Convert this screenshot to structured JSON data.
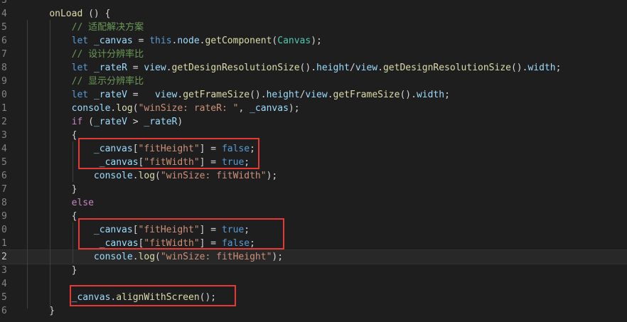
{
  "editor": {
    "lines": [
      {
        "number": "3",
        "tokens": []
      },
      {
        "number": "4",
        "tokens": [
          {
            "text": "    ",
            "cls": "pun"
          },
          {
            "text": "onLoad",
            "cls": "fn"
          },
          {
            "text": " () {",
            "cls": "pun"
          }
        ]
      },
      {
        "number": "5",
        "tokens": [
          {
            "text": "        ",
            "cls": "pun"
          },
          {
            "text": "// 适配解决方案",
            "cls": "cmt"
          }
        ]
      },
      {
        "number": "6",
        "tokens": [
          {
            "text": "        ",
            "cls": "pun"
          },
          {
            "text": "let",
            "cls": "kw"
          },
          {
            "text": " ",
            "cls": "pun"
          },
          {
            "text": "_canvas",
            "cls": "var"
          },
          {
            "text": " = ",
            "cls": "pun"
          },
          {
            "text": "this",
            "cls": "kw"
          },
          {
            "text": ".",
            "cls": "pun"
          },
          {
            "text": "node",
            "cls": "var"
          },
          {
            "text": ".",
            "cls": "pun"
          },
          {
            "text": "getComponent",
            "cls": "fn"
          },
          {
            "text": "(",
            "cls": "pun"
          },
          {
            "text": "Canvas",
            "cls": "cls"
          },
          {
            "text": ");",
            "cls": "pun"
          }
        ]
      },
      {
        "number": "7",
        "tokens": [
          {
            "text": "        ",
            "cls": "pun"
          },
          {
            "text": "// 设计分辨率比",
            "cls": "cmt"
          }
        ]
      },
      {
        "number": "8",
        "tokens": [
          {
            "text": "        ",
            "cls": "pun"
          },
          {
            "text": "let",
            "cls": "kw"
          },
          {
            "text": " ",
            "cls": "pun"
          },
          {
            "text": "_rateR",
            "cls": "var"
          },
          {
            "text": " = ",
            "cls": "pun"
          },
          {
            "text": "view",
            "cls": "var"
          },
          {
            "text": ".",
            "cls": "pun"
          },
          {
            "text": "getDesignResolutionSize",
            "cls": "fn"
          },
          {
            "text": "().",
            "cls": "pun"
          },
          {
            "text": "height",
            "cls": "var"
          },
          {
            "text": "/",
            "cls": "pun"
          },
          {
            "text": "view",
            "cls": "var"
          },
          {
            "text": ".",
            "cls": "pun"
          },
          {
            "text": "getDesignResolutionSize",
            "cls": "fn"
          },
          {
            "text": "().",
            "cls": "pun"
          },
          {
            "text": "width",
            "cls": "var"
          },
          {
            "text": ";",
            "cls": "pun"
          }
        ]
      },
      {
        "number": "9",
        "tokens": [
          {
            "text": "        ",
            "cls": "pun"
          },
          {
            "text": "// 显示分辨率比",
            "cls": "cmt"
          }
        ]
      },
      {
        "number": "0",
        "tokens": [
          {
            "text": "        ",
            "cls": "pun"
          },
          {
            "text": "let",
            "cls": "kw"
          },
          {
            "text": " ",
            "cls": "pun"
          },
          {
            "text": "_rateV",
            "cls": "var"
          },
          {
            "text": " =   ",
            "cls": "pun"
          },
          {
            "text": "view",
            "cls": "var"
          },
          {
            "text": ".",
            "cls": "pun"
          },
          {
            "text": "getFrameSize",
            "cls": "fn"
          },
          {
            "text": "().",
            "cls": "pun"
          },
          {
            "text": "height",
            "cls": "var"
          },
          {
            "text": "/",
            "cls": "pun"
          },
          {
            "text": "view",
            "cls": "var"
          },
          {
            "text": ".",
            "cls": "pun"
          },
          {
            "text": "getFrameSize",
            "cls": "fn"
          },
          {
            "text": "().",
            "cls": "pun"
          },
          {
            "text": "width",
            "cls": "var"
          },
          {
            "text": ";",
            "cls": "pun"
          }
        ]
      },
      {
        "number": "1",
        "tokens": [
          {
            "text": "        ",
            "cls": "pun"
          },
          {
            "text": "console",
            "cls": "var"
          },
          {
            "text": ".",
            "cls": "pun"
          },
          {
            "text": "log",
            "cls": "fn"
          },
          {
            "text": "(",
            "cls": "pun"
          },
          {
            "text": "\"winSize: rateR: \"",
            "cls": "str"
          },
          {
            "text": ", ",
            "cls": "pun"
          },
          {
            "text": "_canvas",
            "cls": "var"
          },
          {
            "text": ");",
            "cls": "pun"
          }
        ]
      },
      {
        "number": "2",
        "tokens": [
          {
            "text": "        ",
            "cls": "pun"
          },
          {
            "text": "if",
            "cls": "ctl"
          },
          {
            "text": " (",
            "cls": "pun"
          },
          {
            "text": "_rateV",
            "cls": "var"
          },
          {
            "text": " > ",
            "cls": "pun"
          },
          {
            "text": "_rateR",
            "cls": "var"
          },
          {
            "text": ")",
            "cls": "pun"
          }
        ]
      },
      {
        "number": "3",
        "tokens": [
          {
            "text": "        {",
            "cls": "pun"
          }
        ]
      },
      {
        "number": "4",
        "tokens": [
          {
            "text": "            ",
            "cls": "pun"
          },
          {
            "text": "_canvas",
            "cls": "var"
          },
          {
            "text": "[",
            "cls": "pun"
          },
          {
            "text": "\"fitHeight\"",
            "cls": "str"
          },
          {
            "text": "] = ",
            "cls": "pun"
          },
          {
            "text": "false",
            "cls": "kw"
          },
          {
            "text": ";",
            "cls": "pun"
          }
        ]
      },
      {
        "number": "5",
        "tokens": [
          {
            "text": "             ",
            "cls": "pun"
          },
          {
            "text": "_canvas",
            "cls": "var"
          },
          {
            "text": "[",
            "cls": "pun"
          },
          {
            "text": "\"fitWidth\"",
            "cls": "str"
          },
          {
            "text": "] = ",
            "cls": "pun"
          },
          {
            "text": "true",
            "cls": "kw"
          },
          {
            "text": ";",
            "cls": "pun"
          }
        ]
      },
      {
        "number": "6",
        "tokens": [
          {
            "text": "            ",
            "cls": "pun"
          },
          {
            "text": "console",
            "cls": "var"
          },
          {
            "text": ".",
            "cls": "pun"
          },
          {
            "text": "log",
            "cls": "fn"
          },
          {
            "text": "(",
            "cls": "pun"
          },
          {
            "text": "\"winSize: fitWidth\"",
            "cls": "str"
          },
          {
            "text": ");",
            "cls": "pun"
          }
        ]
      },
      {
        "number": "7",
        "tokens": [
          {
            "text": "        }",
            "cls": "pun"
          }
        ]
      },
      {
        "number": "8",
        "tokens": [
          {
            "text": "        ",
            "cls": "pun"
          },
          {
            "text": "else",
            "cls": "ctl"
          }
        ]
      },
      {
        "number": "9",
        "tokens": [
          {
            "text": "        {",
            "cls": "pun"
          }
        ]
      },
      {
        "number": "0",
        "tokens": [
          {
            "text": "            ",
            "cls": "pun"
          },
          {
            "text": "_canvas",
            "cls": "var"
          },
          {
            "text": "[",
            "cls": "pun"
          },
          {
            "text": "\"fitHeight\"",
            "cls": "str"
          },
          {
            "text": "] = ",
            "cls": "pun"
          },
          {
            "text": "true",
            "cls": "kw"
          },
          {
            "text": ";",
            "cls": "pun"
          }
        ]
      },
      {
        "number": "1",
        "tokens": [
          {
            "text": "             ",
            "cls": "pun"
          },
          {
            "text": "_canvas",
            "cls": "var"
          },
          {
            "text": "[",
            "cls": "pun"
          },
          {
            "text": "\"fitWidth\"",
            "cls": "str"
          },
          {
            "text": "] = ",
            "cls": "pun"
          },
          {
            "text": "false",
            "cls": "kw"
          },
          {
            "text": ";",
            "cls": "pun"
          }
        ]
      },
      {
        "number": "2",
        "tokens": [
          {
            "text": "            ",
            "cls": "pun"
          },
          {
            "text": "console",
            "cls": "var"
          },
          {
            "text": ".",
            "cls": "pun"
          },
          {
            "text": "log",
            "cls": "fn"
          },
          {
            "text": "(",
            "cls": "pun"
          },
          {
            "text": "\"winSize: fitHeight\"",
            "cls": "str"
          },
          {
            "text": ");",
            "cls": "pun"
          }
        ]
      },
      {
        "number": "3",
        "tokens": [
          {
            "text": "        }",
            "cls": "pun"
          }
        ]
      },
      {
        "number": "4",
        "tokens": []
      },
      {
        "number": "5",
        "tokens": [
          {
            "text": "        ",
            "cls": "pun"
          },
          {
            "text": "_canvas",
            "cls": "var"
          },
          {
            "text": ".",
            "cls": "pun"
          },
          {
            "text": "alignWithScreen",
            "cls": "fn"
          },
          {
            "text": "();",
            "cls": "pun"
          }
        ]
      },
      {
        "number": "6",
        "tokens": [
          {
            "text": "    }",
            "cls": "pun"
          }
        ]
      }
    ],
    "current_line_index": 19
  },
  "colors": {
    "background": "#1e1e1e",
    "highlight_box": "#e53935",
    "keyword": "#569cd6",
    "control": "#c586c0",
    "function": "#dcdcaa",
    "string": "#ce9178",
    "comment": "#6a9955",
    "variable": "#9cdcfe",
    "class": "#4ec9b0"
  }
}
